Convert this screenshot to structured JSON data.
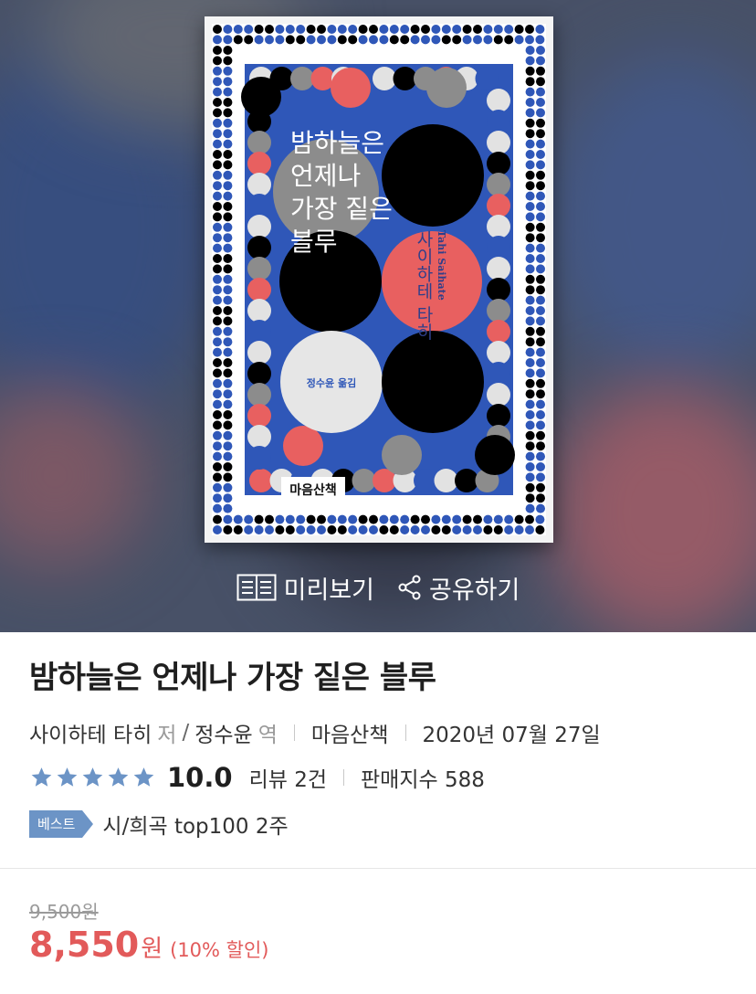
{
  "cover": {
    "title_lines": [
      "밤하늘은",
      "언제나",
      "가장 짙은",
      "블루"
    ],
    "author_vertical": "사이하테 타히",
    "author_latin": "Tahi Saihate",
    "translator": "정수윤 옮김",
    "publisher": "마음산책"
  },
  "actions": {
    "preview": "미리보기",
    "share": "공유하기"
  },
  "book": {
    "title": "밤하늘은 언제나 가장 짙은 블루",
    "author": "사이하테 타히",
    "author_role": "저",
    "slash": "/",
    "translator": "정수윤",
    "translator_role": "역",
    "publisher": "마음산책",
    "date": "2020년 07월 27일",
    "stars": 5,
    "score": "10.0",
    "reviews": "리뷰 2건",
    "sales": "판매지수 588",
    "best_badge": "베스트",
    "best_text": "시/희곡 top100 2주",
    "original_price": "9,500원",
    "sale_price": "8,550",
    "sale_unit": "원",
    "discount": "(10% 할인)"
  },
  "colors": {
    "cover_blue": "#2f57b8",
    "cover_red": "#e86060",
    "cover_gray": "#8c8c8c",
    "cover_light": "#e2e2e2",
    "star": "#6c94c6",
    "badge": "#6c94c6",
    "price": "#e25a5a"
  }
}
